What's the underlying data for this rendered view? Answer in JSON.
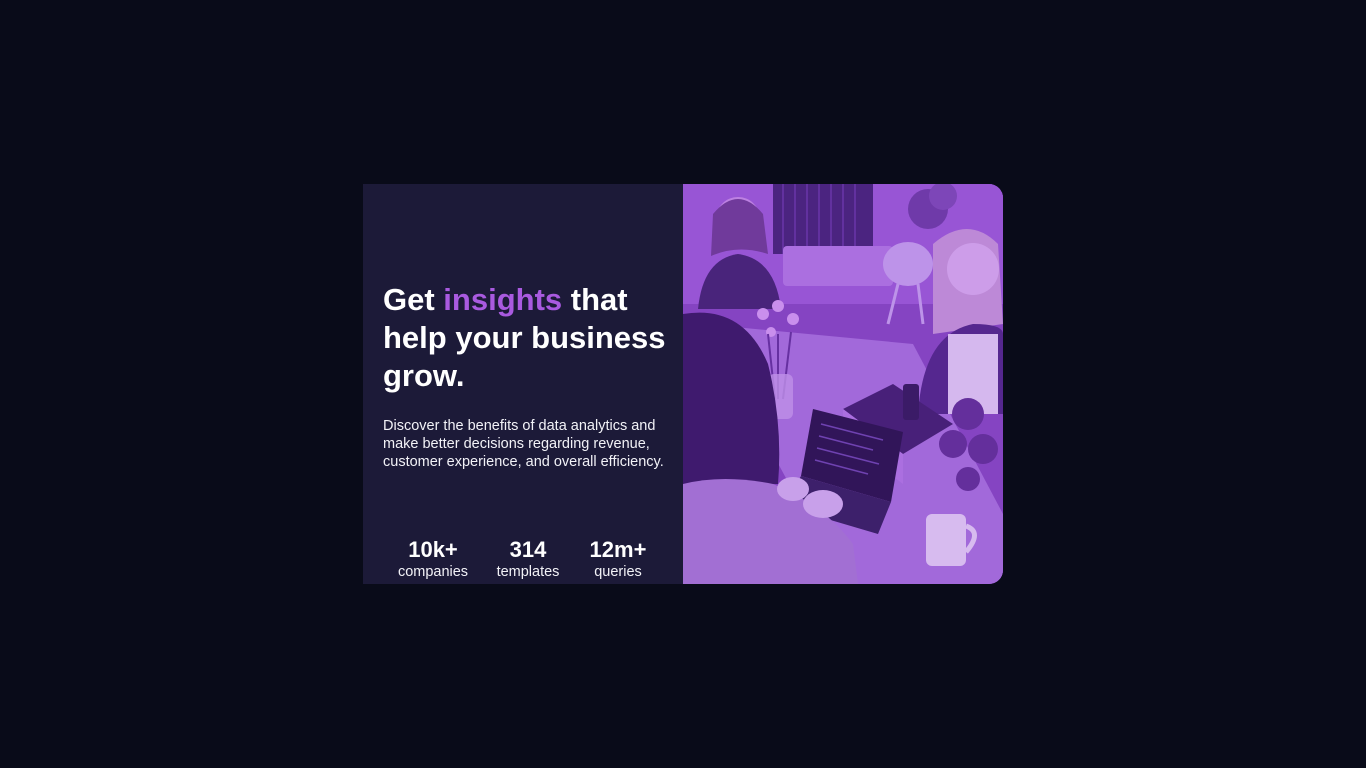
{
  "headline": {
    "part1": "Get ",
    "accent": "insights",
    "part2": " that help your business grow."
  },
  "description": "Discover the benefits of data analytics and make better decisions regarding revenue, customer experience, and overall efficiency.",
  "stats": [
    {
      "value": "10k+",
      "label": "companies"
    },
    {
      "value": "314",
      "label": "templates"
    },
    {
      "value": "12m+",
      "label": "queries"
    }
  ],
  "colors": {
    "page_background": "#090b19",
    "card_background": "#1c1a38",
    "accent": "#a95ae0",
    "image_overlay": "#7a3fb3"
  }
}
